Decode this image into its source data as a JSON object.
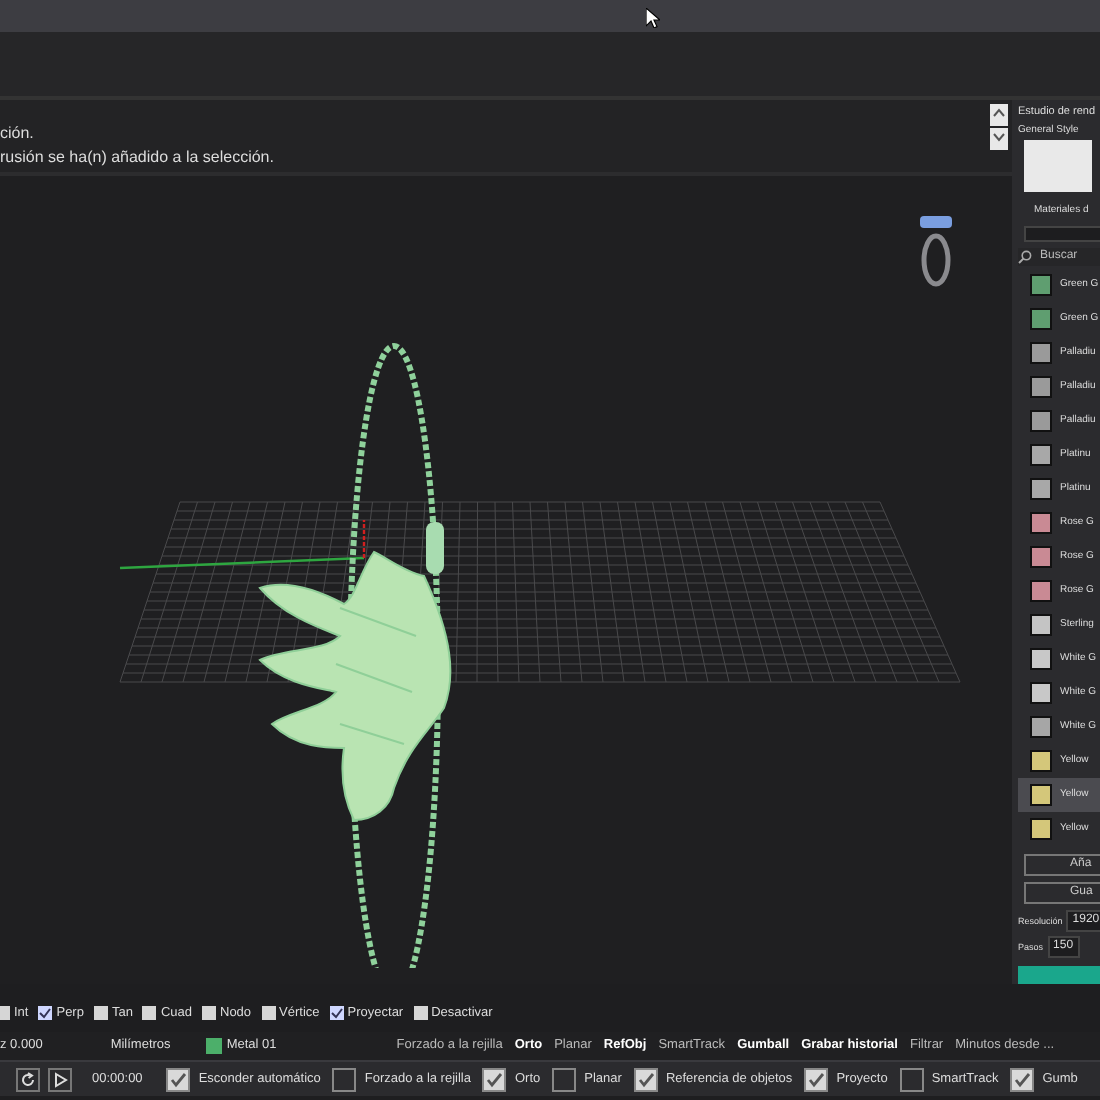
{
  "command_history": {
    "lines": [
      "ción.",
      "rusión se ha(n) añadido a la selección."
    ]
  },
  "render_panel": {
    "title": "Estudio de rend",
    "style_label": "General Style",
    "materials_label": "Materiales d",
    "search": {
      "placeholder": "Buscar"
    },
    "materials": [
      {
        "label": "Green G",
        "color": "#5f9e70",
        "selected": false
      },
      {
        "label": "Green G",
        "color": "#5f9e70",
        "selected": false
      },
      {
        "label": "Palladiu",
        "color": "#9a9a9a",
        "selected": false
      },
      {
        "label": "Palladiu",
        "color": "#9a9a9a",
        "selected": false
      },
      {
        "label": "Palladiu",
        "color": "#9a9a9a",
        "selected": false
      },
      {
        "label": "Platinu",
        "color": "#a8a8a8",
        "selected": false
      },
      {
        "label": "Platinu",
        "color": "#a8a8a8",
        "selected": false
      },
      {
        "label": "Rose G",
        "color": "#c98a94",
        "selected": false
      },
      {
        "label": "Rose G",
        "color": "#c98a94",
        "selected": false
      },
      {
        "label": "Rose G",
        "color": "#c98a94",
        "selected": false
      },
      {
        "label": "Sterling",
        "color": "#c4c4c4",
        "selected": false
      },
      {
        "label": "White G",
        "color": "#c8c8c8",
        "selected": false
      },
      {
        "label": "White G",
        "color": "#c8c8c8",
        "selected": false
      },
      {
        "label": "White G",
        "color": "#a6a6a6",
        "selected": false
      },
      {
        "label": "Yellow",
        "color": "#d4c77a",
        "selected": false
      },
      {
        "label": "Yellow",
        "color": "#d4c77a",
        "selected": true
      },
      {
        "label": "Yellow",
        "color": "#d4c77a",
        "selected": false
      }
    ],
    "buttons": [
      "Aña",
      "Gua"
    ],
    "fields": [
      {
        "label": "Resolución",
        "value": "1920"
      },
      {
        "label": "Pasos",
        "value": "150"
      }
    ]
  },
  "osnaps": [
    {
      "label": "Int",
      "checked": false
    },
    {
      "label": "Perp",
      "checked": true
    },
    {
      "label": "Tan",
      "checked": false
    },
    {
      "label": "Cuad",
      "checked": false
    },
    {
      "label": "Nodo",
      "checked": false
    },
    {
      "label": "Vértice",
      "checked": false
    },
    {
      "label": "Proyectar",
      "checked": true
    },
    {
      "label": "Desactivar",
      "checked": false
    }
  ],
  "status_bar": {
    "coordinate": "z 0.000",
    "units": "Milímetros",
    "layer": {
      "label": "Metal 01",
      "color": "#4caf6a"
    },
    "toggles": [
      {
        "label": "Forzado a la rejilla",
        "on": false
      },
      {
        "label": "Orto",
        "on": true
      },
      {
        "label": "Planar",
        "on": false
      },
      {
        "label": "RefObj",
        "on": true
      },
      {
        "label": "SmartTrack",
        "on": false
      },
      {
        "label": "Gumball",
        "on": true
      },
      {
        "label": "Grabar historial",
        "on": true
      },
      {
        "label": "Filtrar",
        "on": false
      },
      {
        "label": "Minutos desde ...",
        "on": false
      }
    ]
  },
  "bottom_bar": {
    "time": "00:00:00",
    "options": [
      {
        "label": "Esconder automático",
        "checked": true
      },
      {
        "label": "Forzado a la rejilla",
        "checked": false
      },
      {
        "label": "Orto",
        "checked": true
      },
      {
        "label": "Planar",
        "checked": false
      },
      {
        "label": "Referencia de objetos",
        "checked": true
      },
      {
        "label": "Proyecto",
        "checked": true
      },
      {
        "label": "SmartTrack",
        "checked": false
      },
      {
        "label": "Gumb",
        "checked": true
      }
    ]
  }
}
